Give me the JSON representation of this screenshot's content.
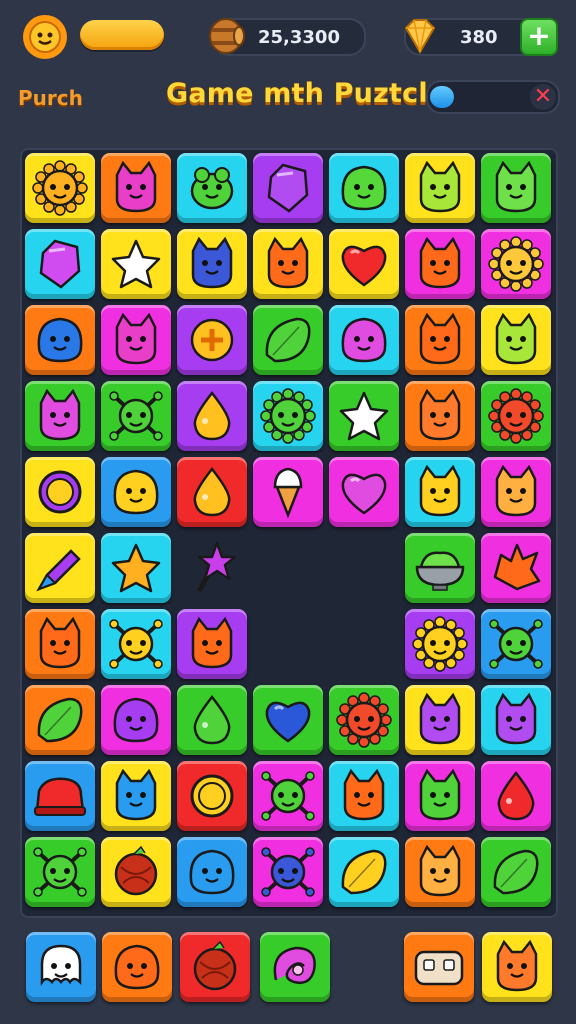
{
  "hud": {
    "left_label": "Purch",
    "title": "Game mth Puztcle",
    "coins": "25,3300",
    "gems": "380",
    "plus": "+",
    "close": "✕",
    "progress_fraction": 0.25
  },
  "colors": {
    "yellow": "#ffe21c",
    "orange": "#ff7a12",
    "cyan": "#26d4f0",
    "purple": "#a63df0",
    "green": "#38cc2a",
    "magenta": "#f030e0",
    "red": "#f02a2a",
    "blue": "#2a9cf0",
    "board": "#1f2636",
    "background": "#2e3648"
  },
  "grid": [
    [
      {
        "c": "yellow",
        "i": "sun",
        "f": "#ffb020"
      },
      {
        "c": "orange",
        "i": "cat",
        "f": "#e83ec8"
      },
      {
        "c": "cyan",
        "i": "frog",
        "f": "#4fd23a"
      },
      {
        "c": "purple",
        "i": "gem",
        "f": "#b04cf0"
      },
      {
        "c": "cyan",
        "i": "blob",
        "f": "#56d83a"
      },
      {
        "c": "yellow",
        "i": "cat",
        "f": "#a8e63a"
      },
      {
        "c": "green",
        "i": "cat",
        "f": "#6fe04a"
      }
    ],
    [
      {
        "c": "cyan",
        "i": "gem",
        "f": "#d04cf0"
      },
      {
        "c": "yellow",
        "i": "star",
        "f": "#ffffff"
      },
      {
        "c": "yellow",
        "i": "cat",
        "f": "#3a58d8"
      },
      {
        "c": "yellow",
        "i": "cat",
        "f": "#ff6a1a"
      },
      {
        "c": "yellow",
        "i": "heart",
        "f": "#f02a2a"
      },
      {
        "c": "magenta",
        "i": "cat",
        "f": "#ff6a1a"
      },
      {
        "c": "magenta",
        "i": "sun",
        "f": "#ffc83a"
      }
    ],
    [
      {
        "c": "orange",
        "i": "blob",
        "f": "#2a78e8"
      },
      {
        "c": "magenta",
        "i": "cat",
        "f": "#e83ec8"
      },
      {
        "c": "purple",
        "i": "plus",
        "f": "#ffc020"
      },
      {
        "c": "green",
        "i": "leaf",
        "f": "#4fd23a"
      },
      {
        "c": "cyan",
        "i": "blob",
        "f": "#e04ce0"
      },
      {
        "c": "orange",
        "i": "cat",
        "f": "#ff6a1a"
      },
      {
        "c": "yellow",
        "i": "cat",
        "f": "#a8e63a"
      }
    ],
    [
      {
        "c": "green",
        "i": "cat",
        "f": "#e04ce0"
      },
      {
        "c": "green",
        "i": "bug",
        "f": "#4fd23a"
      },
      {
        "c": "purple",
        "i": "drop",
        "f": "#ffc020"
      },
      {
        "c": "cyan",
        "i": "sun",
        "f": "#4fd23a"
      },
      {
        "c": "green",
        "i": "star",
        "f": "#ffffff"
      },
      {
        "c": "orange",
        "i": "cat",
        "f": "#ff7a2a"
      },
      {
        "c": "green",
        "i": "sun",
        "f": "#f04a2a"
      }
    ],
    [
      {
        "c": "yellow",
        "i": "ring",
        "f": "#a63df0"
      },
      {
        "c": "blue",
        "i": "blob",
        "f": "#ffd020"
      },
      {
        "c": "red",
        "i": "drop",
        "f": "#ffc020"
      },
      {
        "c": "magenta",
        "i": "cone",
        "f": "#ffffff"
      },
      {
        "c": "magenta",
        "i": "heart",
        "f": "#e04ce0"
      },
      {
        "c": "cyan",
        "i": "cat",
        "f": "#ffd020"
      },
      {
        "c": "magenta",
        "i": "cat",
        "f": "#ffb040"
      }
    ],
    [
      {
        "c": "yellow",
        "i": "pen",
        "f": "#a63df0"
      },
      {
        "c": "cyan",
        "i": "star",
        "f": "#ffb020"
      },
      {
        "c": "empty",
        "i": "wand",
        "f": "#c83ee8"
      },
      null,
      null,
      {
        "c": "green",
        "i": "bowl",
        "f": "#6fe04a"
      },
      {
        "c": "magenta",
        "i": "splat",
        "f": "#ff6a1a"
      }
    ],
    [
      {
        "c": "orange",
        "i": "cat",
        "f": "#ff6a1a"
      },
      {
        "c": "cyan",
        "i": "bug",
        "f": "#ffd020"
      },
      {
        "c": "purple",
        "i": "cat",
        "f": "#ff6a1a"
      },
      null,
      null,
      {
        "c": "purple",
        "i": "sun",
        "f": "#ffd020"
      },
      {
        "c": "blue",
        "i": "bug",
        "f": "#4fd23a"
      }
    ],
    [
      {
        "c": "orange",
        "i": "leaf",
        "f": "#4fd23a"
      },
      {
        "c": "magenta",
        "i": "blob",
        "f": "#a63df0"
      },
      {
        "c": "green",
        "i": "drop",
        "f": "#4fd23a"
      },
      {
        "c": "green",
        "i": "heart",
        "f": "#2a58d8"
      },
      {
        "c": "green",
        "i": "sun",
        "f": "#f04a2a"
      },
      {
        "c": "yellow",
        "i": "cat",
        "f": "#b04cf0"
      },
      {
        "c": "cyan",
        "i": "cat",
        "f": "#b04cf0"
      }
    ],
    [
      {
        "c": "blue",
        "i": "hat",
        "f": "#f02a2a"
      },
      {
        "c": "yellow",
        "i": "cat",
        "f": "#2a9cf0"
      },
      {
        "c": "red",
        "i": "ring",
        "f": "#ffd020"
      },
      {
        "c": "magenta",
        "i": "bug",
        "f": "#4fd23a"
      },
      {
        "c": "cyan",
        "i": "cat",
        "f": "#ff6a1a"
      },
      {
        "c": "magenta",
        "i": "cat",
        "f": "#4fd23a"
      },
      {
        "c": "magenta",
        "i": "drop",
        "f": "#f02a2a"
      }
    ],
    [
      {
        "c": "green",
        "i": "bug",
        "f": "#4fd23a"
      },
      {
        "c": "yellow",
        "i": "ball",
        "f": "#c8301a"
      },
      {
        "c": "blue",
        "i": "blob",
        "f": "#2a9cf0"
      },
      {
        "c": "magenta",
        "i": "bug",
        "f": "#3a58d8"
      },
      {
        "c": "cyan",
        "i": "leaf",
        "f": "#ffd020"
      },
      {
        "c": "orange",
        "i": "cat",
        "f": "#ffb040"
      },
      {
        "c": "green",
        "i": "leaf",
        "f": "#4fd23a"
      }
    ]
  ],
  "tray": [
    {
      "c": "blue",
      "i": "ghost",
      "f": "#ffffff"
    },
    {
      "c": "orange",
      "i": "blob",
      "f": "#ff6a1a"
    },
    {
      "c": "red",
      "i": "ball",
      "f": "#c8301a"
    },
    {
      "c": "green",
      "i": "shell",
      "f": "#e04ce0"
    },
    {
      "c": "orange",
      "i": "bread",
      "f": "#f0e0c8"
    },
    {
      "c": "yellow",
      "i": "cat",
      "f": "#ff7a2a"
    }
  ]
}
